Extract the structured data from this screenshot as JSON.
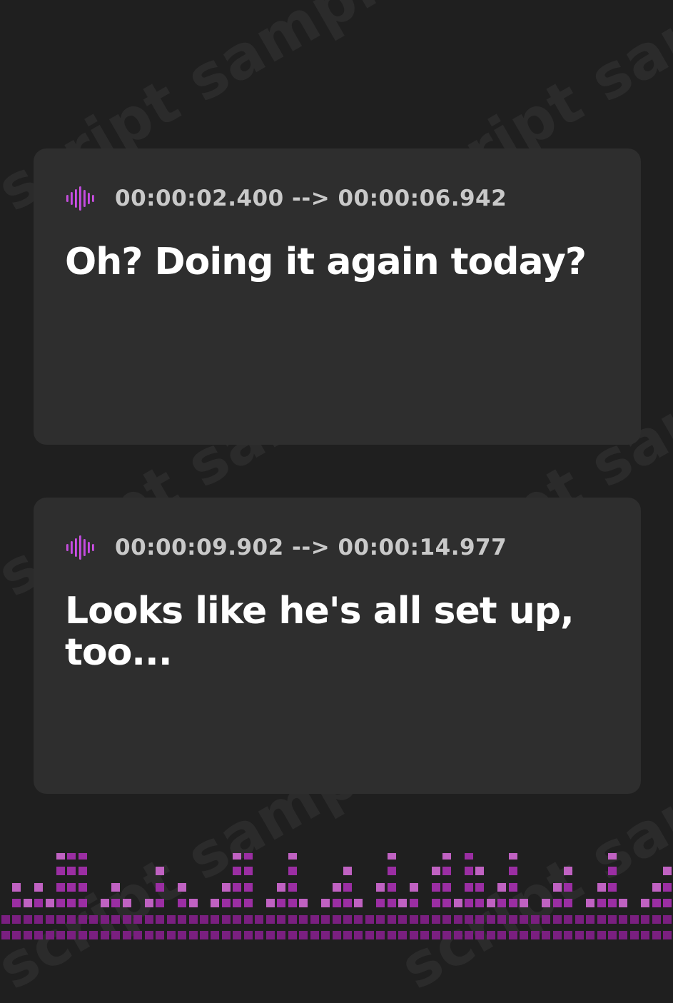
{
  "watermark": {
    "text": "script sample"
  },
  "cues": [
    {
      "timestamp": "00:00:02.400 --> 00:00:06.942",
      "text": "Oh? Doing it again today?"
    },
    {
      "timestamp": "00:00:09.902 --> 00:00:14.977",
      "text": "Looks like he's all set up, too..."
    }
  ],
  "icons": {
    "cue_icon": "audio-wave-icon"
  },
  "colors": {
    "background": "#1f1f1f",
    "card": "#2e2e2e",
    "accent_pink": "#e05ce0",
    "accent_purple": "#a23bd6",
    "equalizer_dim": "#7a1f80",
    "equalizer_mid": "#9b2ea3",
    "equalizer_top": "#c062c2",
    "timestamp_text": "#c9c9c9",
    "caption_text": "#ffffff"
  },
  "equalizer": {
    "levels": [
      2,
      4,
      3,
      4,
      3,
      6,
      7,
      7,
      2,
      3,
      4,
      3,
      2,
      3,
      5,
      2,
      4,
      3,
      2,
      3,
      4,
      6,
      7,
      2,
      3,
      4,
      6,
      3,
      2,
      3,
      4,
      5,
      3,
      2,
      4,
      6,
      3,
      4,
      2,
      5,
      6,
      3,
      7,
      5,
      3,
      4,
      6,
      3,
      2,
      3,
      4,
      5,
      2,
      3,
      4,
      6,
      3,
      2,
      3,
      4,
      5
    ]
  }
}
